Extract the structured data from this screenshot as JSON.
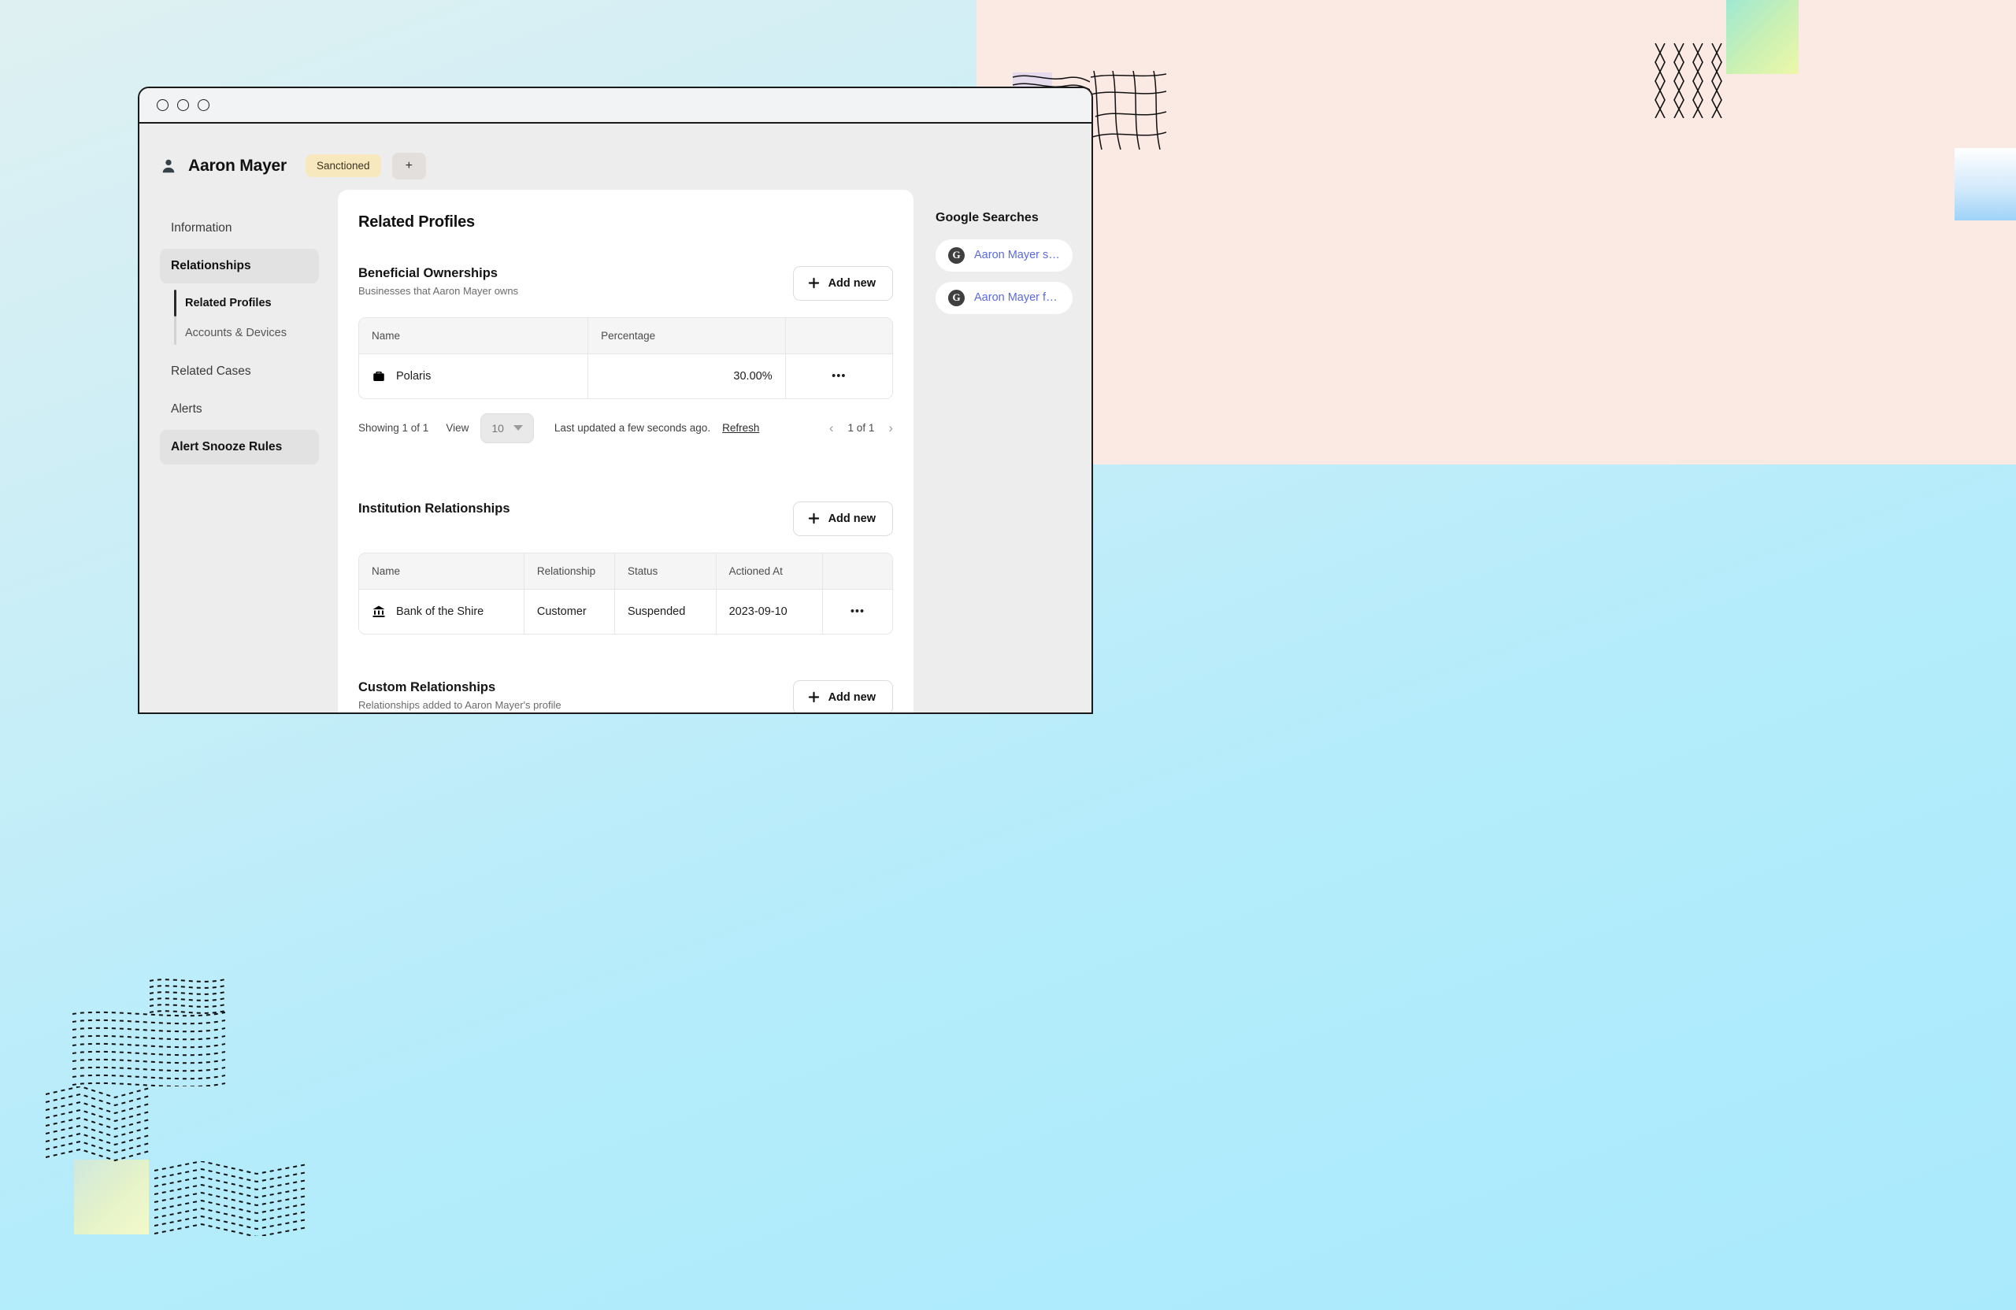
{
  "window": {
    "traffic_lights": [
      "close",
      "minimize",
      "maximize"
    ]
  },
  "profile_header": {
    "avatar_icon": "person-icon",
    "name": "Aaron Mayer",
    "status_badge": "Sanctioned",
    "add_tag_label": "+"
  },
  "sidebar": {
    "items": [
      {
        "label": "Information",
        "active": false
      },
      {
        "label": "Relationships",
        "active": true
      }
    ],
    "subitems": [
      {
        "label": "Related Profiles",
        "active": true
      },
      {
        "label": "Accounts & Devices",
        "active": false
      }
    ],
    "items_after": [
      {
        "label": "Related Cases",
        "active": false
      },
      {
        "label": "Alerts",
        "active": false
      },
      {
        "label": "Alert Snooze Rules",
        "active": true
      }
    ]
  },
  "main": {
    "title": "Related Profiles",
    "sections": [
      {
        "title": "Beneficial Ownerships",
        "subtitle": "Businesses that Aaron Mayer owns",
        "add_label": "Add new",
        "columns": [
          "Name",
          "Percentage",
          ""
        ],
        "rows": [
          {
            "icon": "briefcase-icon",
            "name": "Polaris",
            "percentage": "30.00%",
            "menu": "•••"
          }
        ],
        "footer": {
          "showing": "Showing 1 of 1",
          "view_label": "View",
          "page_size": "10",
          "last_updated": "Last updated a few seconds ago.",
          "refresh": "Refresh",
          "prev": "‹",
          "page_indicator": "1 of 1",
          "next": "›"
        }
      },
      {
        "title": "Institution Relationships",
        "subtitle": "",
        "add_label": "Add new",
        "columns": [
          "Name",
          "Relationship",
          "Status",
          "Actioned At",
          ""
        ],
        "rows": [
          {
            "icon": "bank-icon",
            "name": "Bank of the Shire",
            "relationship": "Customer",
            "status": "Suspended",
            "actioned_at": "2023-09-10",
            "menu": "•••"
          }
        ]
      },
      {
        "title": "Custom Relationships",
        "subtitle": "Relationships added to Aaron Mayer's profile",
        "add_label": "Add new"
      }
    ]
  },
  "right_rail": {
    "title": "Google Searches",
    "searches": [
      {
        "icon": "google-icon",
        "query": "Aaron Mayer scam"
      },
      {
        "icon": "google-icon",
        "query": "Aaron Mayer fraud"
      }
    ]
  },
  "colors": {
    "page_background_start": "#dff0f2",
    "page_background_end": "#a9eafc",
    "decor_pink": "#fbe9e4",
    "app_background": "#ededed",
    "card_background": "#ffffff",
    "badge_sanctioned": "#f7e9bd",
    "link_blue": "#5b6ae0",
    "active_nav": "#e2e2e2"
  }
}
